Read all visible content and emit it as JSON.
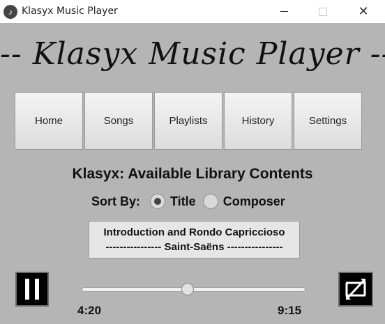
{
  "window": {
    "title": "Klasyx Music Player",
    "icon": "music-note-icon",
    "controls": {
      "minimize": "minimize-icon",
      "maximize": "maximize-icon",
      "close": "close-icon"
    }
  },
  "banner": {
    "text": "-- Klasyx Music Player --"
  },
  "nav": {
    "items": [
      "Home",
      "Songs",
      "Playlists",
      "History",
      "Settings"
    ]
  },
  "main": {
    "heading": "Klasyx: Available Library Contents",
    "sort": {
      "label": "Sort By:",
      "options": [
        {
          "label": "Title",
          "selected": true
        },
        {
          "label": "Composer",
          "selected": false
        }
      ]
    },
    "song": {
      "title": "Introduction and Rondo Capriccioso",
      "composer_line": "---------------- Saint-Saëns ----------------"
    }
  },
  "player": {
    "elapsed": "4:20",
    "total": "9:15",
    "progress_fraction": 0.472,
    "pause_icon": "pause-icon",
    "shuffle_icon": "shuffle-icon"
  }
}
